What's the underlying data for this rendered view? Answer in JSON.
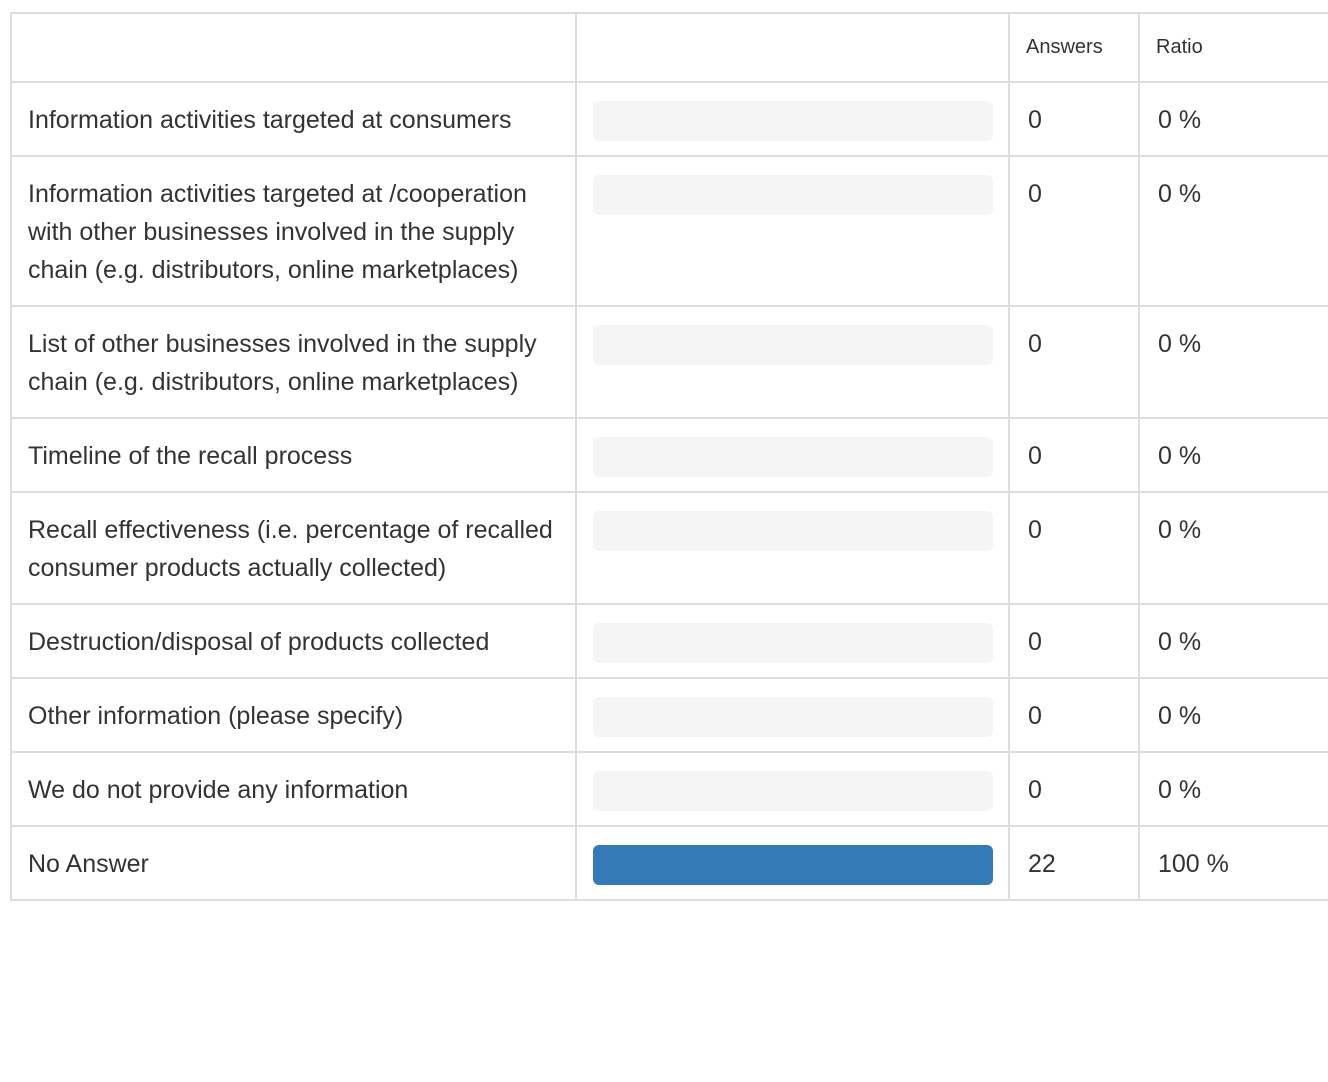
{
  "table": {
    "headers": {
      "label": "",
      "bar": "",
      "answers": "Answers",
      "ratio": "Ratio"
    },
    "rows": [
      {
        "label": "Information activities targeted at consumers",
        "answers": "0",
        "ratio": "0 %",
        "fill": 0
      },
      {
        "label": "Information activities targeted at /cooperation with other businesses involved in the supply chain (e.g. distributors, online marketplaces)",
        "answers": "0",
        "ratio": "0 %",
        "fill": 0
      },
      {
        "label": "List of other businesses involved in the supply chain (e.g. distributors, online marketplaces)",
        "answers": "0",
        "ratio": "0 %",
        "fill": 0
      },
      {
        "label": "Timeline of the recall process",
        "answers": "0",
        "ratio": "0 %",
        "fill": 0
      },
      {
        "label": "Recall effectiveness (i.e. percentage of recalled consumer products actually collected)",
        "answers": "0",
        "ratio": "0 %",
        "fill": 0
      },
      {
        "label": "Destruction/disposal of products collected",
        "answers": "0",
        "ratio": "0 %",
        "fill": 0
      },
      {
        "label": "Other information (please specify)",
        "answers": "0",
        "ratio": "0 %",
        "fill": 0
      },
      {
        "label": "We do not provide any information",
        "answers": "0",
        "ratio": "0 %",
        "fill": 0
      },
      {
        "label": "No Answer",
        "answers": "22",
        "ratio": "100 %",
        "fill": 100
      }
    ]
  },
  "colors": {
    "bar_fill": "#337ab7",
    "bar_track": "#f5f5f5",
    "border": "#dddddd"
  }
}
